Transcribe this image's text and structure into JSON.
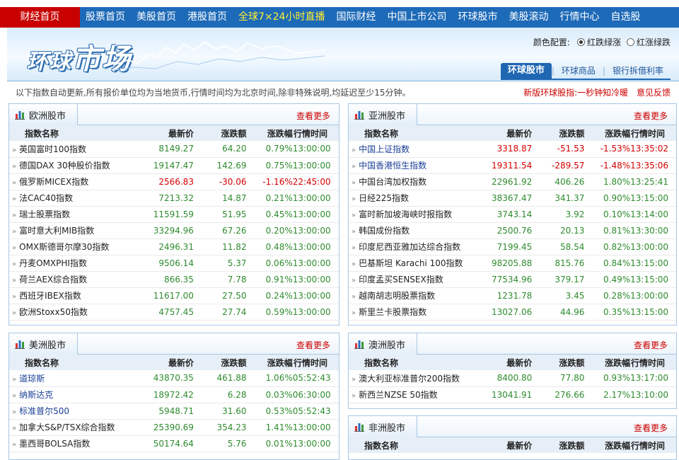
{
  "nav": {
    "items": [
      "财经首页",
      "股票首页",
      "美股首页",
      "港股首页",
      "全球7×24小时直播",
      "国际财经",
      "中国上市公司",
      "环球股市",
      "美股滚动",
      "行情中心",
      "自选股"
    ]
  },
  "banner": {
    "logo_a": "环球",
    "logo_b": "市场",
    "color_label": "颜色配置:",
    "opt1": "红跌绿涨",
    "opt2": "红涨绿跌",
    "tabs": [
      "环球股市",
      "环球商品",
      "银行拆借利率"
    ]
  },
  "note": "以下指数自动更新,所有报价单位均为当地货币,行情时间均为北京时间,除非特殊说明,均延迟至少15分钟。",
  "note_links": [
    "新版环球股指:一秒钟知冷暖",
    "意见反馈"
  ],
  "headers": [
    "指数名称",
    "最新价",
    "涨跌额",
    "涨跌幅",
    "行情时间"
  ],
  "more": "查看更多",
  "europe": {
    "title": "欧洲股市",
    "rows": [
      [
        "英国富时100指数",
        "8149.27",
        "64.20",
        "0.79%",
        "13:00:00"
      ],
      [
        "德国DAX 30种股价指数",
        "19147.47",
        "142.69",
        "0.75%",
        "13:00:00"
      ],
      [
        "俄罗斯MICEX指数",
        "2566.83",
        "-30.06",
        "-1.16%",
        "22:45:00"
      ],
      [
        "法CAC40指数",
        "7213.32",
        "14.87",
        "0.21%",
        "13:00:00"
      ],
      [
        "瑞士股票指数",
        "11591.59",
        "51.95",
        "0.45%",
        "13:00:00"
      ],
      [
        "富时意大利MIB指数",
        "33294.96",
        "67.26",
        "0.20%",
        "13:00:00"
      ],
      [
        "OMX斯德哥尔摩30指数",
        "2496.31",
        "11.82",
        "0.48%",
        "13:00:00"
      ],
      [
        "丹麦OMXPHI指数",
        "9506.14",
        "5.37",
        "0.06%",
        "13:00:00"
      ],
      [
        "荷兰AEX综合指数",
        "866.35",
        "7.78",
        "0.91%",
        "13:00:00"
      ],
      [
        "西班牙IBEX指数",
        "11617.00",
        "27.50",
        "0.24%",
        "13:00:00"
      ],
      [
        "欧洲Stoxx50指数",
        "4757.45",
        "27.74",
        "0.59%",
        "13:00:00"
      ]
    ]
  },
  "asia": {
    "title": "亚洲股市",
    "rows": [
      [
        "中国上证指数",
        "3318.87",
        "-51.53",
        "-1.53%",
        "13:35:02"
      ],
      [
        "中国香港恒生指数",
        "19311.54",
        "-289.57",
        "-1.48%",
        "13:35:06"
      ],
      [
        "中国台湾加权指数",
        "22961.92",
        "406.26",
        "1.80%",
        "13:25:41"
      ],
      [
        "日经225指数",
        "38367.47",
        "341.37",
        "0.90%",
        "13:15:00"
      ],
      [
        "富时新加坡海峡时报指数",
        "3743.14",
        "3.92",
        "0.10%",
        "13:14:00"
      ],
      [
        "韩国成份指数",
        "2500.76",
        "20.13",
        "0.81%",
        "13:30:00"
      ],
      [
        "印度尼西亚雅加达综合指数",
        "7199.45",
        "58.54",
        "0.82%",
        "13:00:00"
      ],
      [
        "巴基斯坦 Karachi 100指数",
        "98205.88",
        "815.76",
        "0.84%",
        "13:15:00"
      ],
      [
        "印度孟买SENSEX指数",
        "77534.96",
        "379.17",
        "0.49%",
        "13:15:00"
      ],
      [
        "越南胡志明股票指数",
        "1231.78",
        "3.45",
        "0.28%",
        "13:00:00"
      ],
      [
        "斯里兰卡股票指数",
        "13027.06",
        "44.96",
        "0.35%",
        "13:15:00"
      ]
    ]
  },
  "america": {
    "title": "美洲股市",
    "rows": [
      [
        "道琼斯",
        "43870.35",
        "461.88",
        "1.06%",
        "05:52:43"
      ],
      [
        "纳斯达克",
        "18972.42",
        "6.28",
        "0.03%",
        "06:30:00"
      ],
      [
        "标准普尔500",
        "5948.71",
        "31.60",
        "0.53%",
        "05:52:43"
      ],
      [
        "加拿大S&P/TSX综合指数",
        "25390.69",
        "354.23",
        "1.41%",
        "13:00:00"
      ],
      [
        "墨西哥BOLSA指数",
        "50174.64",
        "5.76",
        "0.01%",
        "13:00:00"
      ]
    ]
  },
  "australia": {
    "title": "澳洲股市",
    "rows": [
      [
        "澳大利亚标准普尔200指数",
        "8400.80",
        "77.80",
        "0.93%",
        "13:17:00"
      ],
      [
        "新西兰NZSE 50指数",
        "13041.91",
        "276.66",
        "2.17%",
        "13:10:00"
      ]
    ]
  },
  "africa": {
    "title": "非洲股市"
  },
  "colors": {
    "nav": "#1d6ab8",
    "home": "#c80000",
    "up": "#2e8b2e",
    "down": "#d40000",
    "link": "#1a3f97"
  }
}
